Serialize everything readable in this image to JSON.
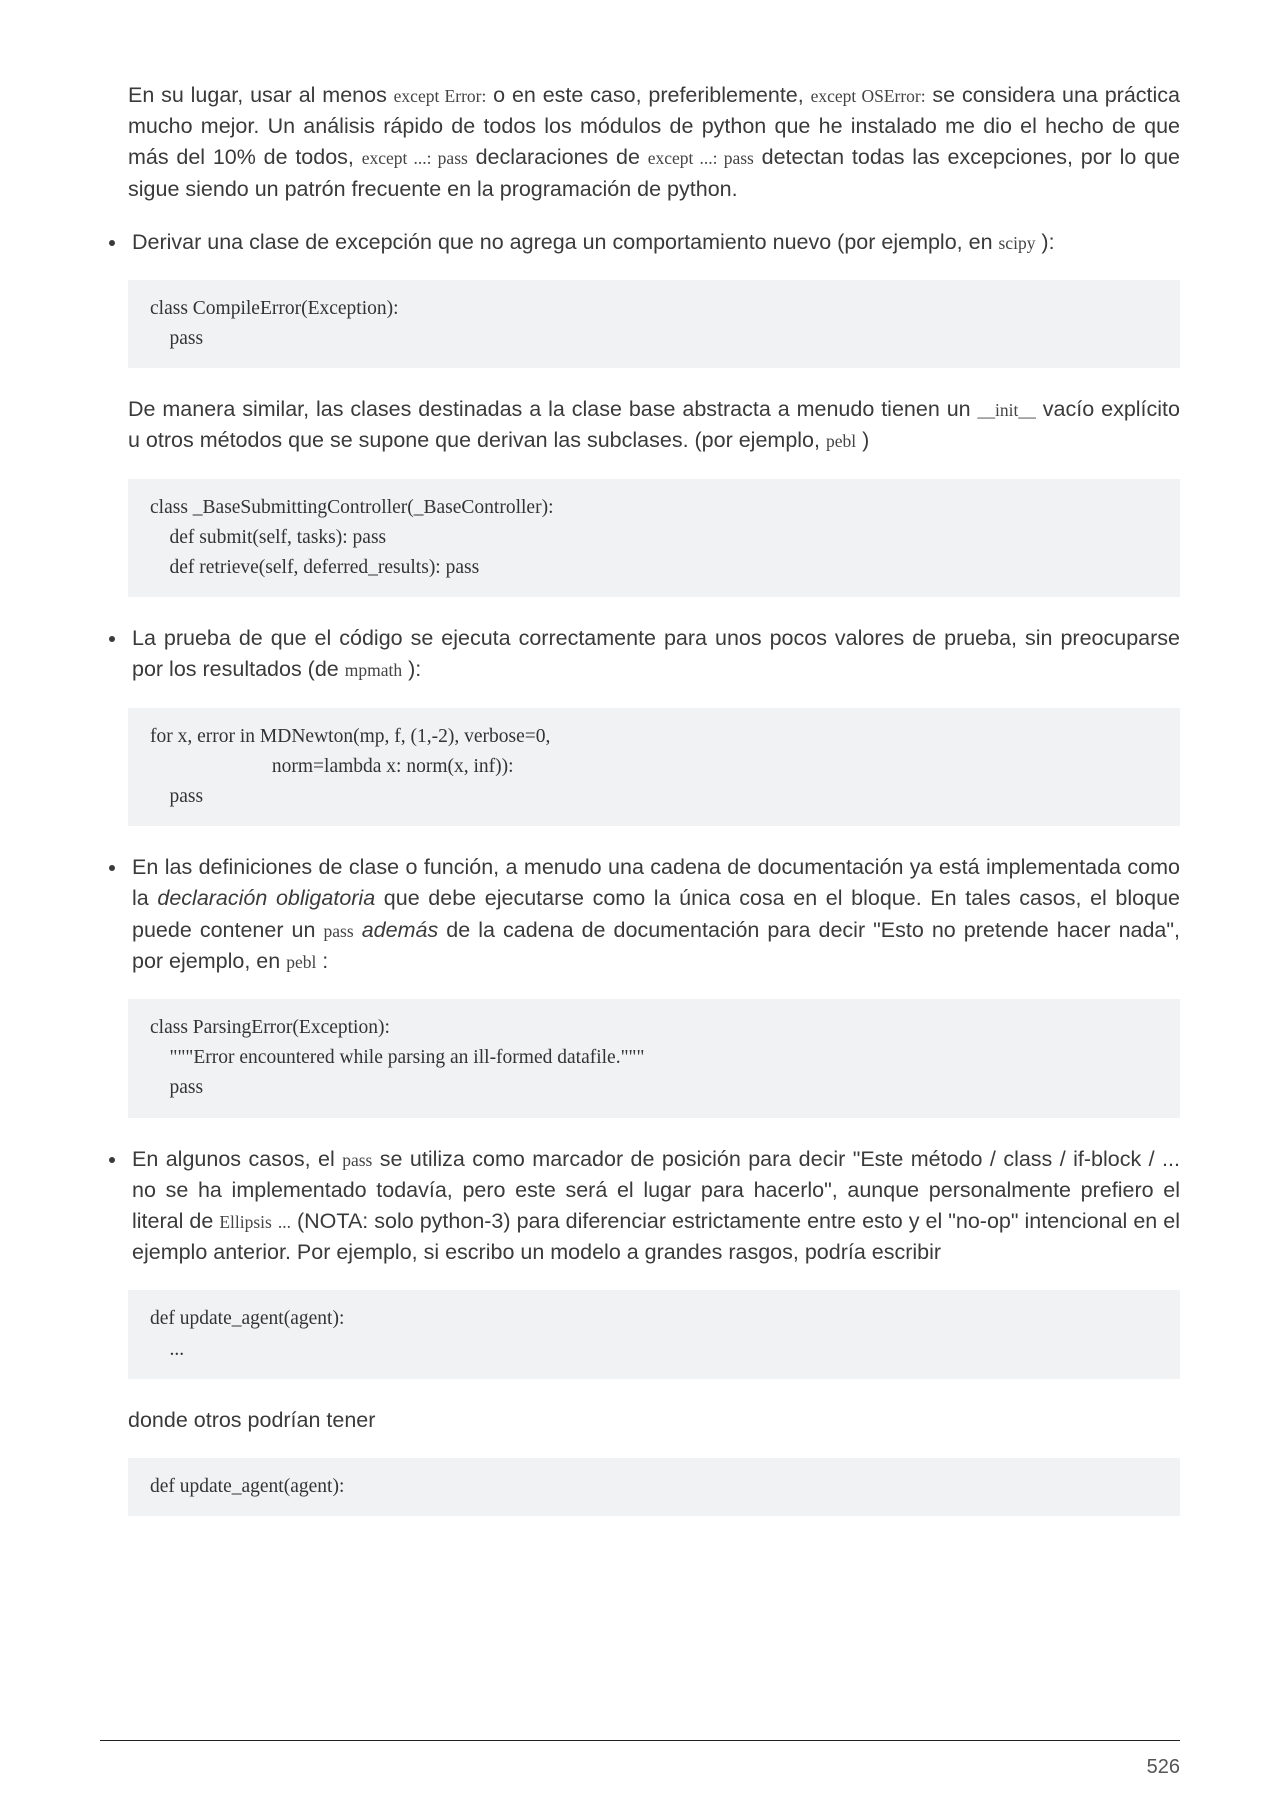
{
  "intro": {
    "t1": "En su lugar, usar al menos ",
    "c1": "except Error:",
    "t2": " o en este caso, preferiblemente, ",
    "c2": "except OSError:",
    "t3": " se considera una práctica mucho mejor. Un análisis rápido de todos los módulos de python que he instalado me dio el hecho de que más del 10% de todos, ",
    "c3": "except ...: pass",
    "t4": " declaraciones de ",
    "c4": "except ...: pass",
    "t5": " detectan todas las excepciones, por lo que sigue siendo un patrón frecuente en la programación de python."
  },
  "bullet1": {
    "t1": "Derivar una clase de excepción que no agrega un comportamiento nuevo (por ejemplo, en ",
    "c1": "scipy",
    "t2": " ):"
  },
  "code1": "class CompileError(Exception):\n    pass",
  "para2": {
    "t1": "De manera similar, las clases destinadas a la clase base abstracta a menudo tienen un ",
    "c1": "__init__",
    "t2": " vacío explícito u otros métodos que se supone que derivan las subclases. (por ejemplo, ",
    "c2": "pebl",
    "t3": " )"
  },
  "code2": "class _BaseSubmittingController(_BaseController):\n    def submit(self, tasks): pass\n    def retrieve(self, deferred_results): pass",
  "bullet2": {
    "t1": "La prueba de que el código se ejecuta correctamente para unos pocos valores de prueba, sin preocuparse por los resultados (de ",
    "c1": "mpmath",
    "t2": " ):"
  },
  "code3": "for x, error in MDNewton(mp, f, (1,-2), verbose=0,\n                         norm=lambda x: norm(x, inf)):\n    pass",
  "bullet3": {
    "t1": "En las definiciones de clase o función, a menudo una cadena de documentación ya está implementada como la ",
    "em1": "declaración obligatoria",
    "t2": " que debe ejecutarse como la única cosa en el bloque. En tales casos, el bloque puede contener un ",
    "c1": "pass",
    "t3": " ",
    "em2": "además",
    "t4": " de la cadena de documentación para decir \"Esto no pretende hacer nada\", por ejemplo, en ",
    "c2": "pebl",
    "t5": " :"
  },
  "code4": "class ParsingError(Exception):\n    \"\"\"Error encountered while parsing an ill-formed datafile.\"\"\"\n    pass",
  "bullet4": {
    "t1": "En algunos casos, el ",
    "c1": "pass",
    "t2": " se utiliza como marcador de posición para decir \"Este método / class / if-block / ... no se ha implementado todavía, pero este será el lugar para hacerlo\", aunque personalmente prefiero el literal de ",
    "c2": "Ellipsis",
    "t3": " ",
    "c3": "...",
    "t4": " (NOTA: solo python-3) para diferenciar estrictamente entre esto y el \"no-op\" intencional en el ejemplo anterior. Por ejemplo, si escribo un modelo a grandes rasgos, podría escribir"
  },
  "code5": "def update_agent(agent):\n    ...",
  "para5": "donde otros podrían tener",
  "code6": "def update_agent(agent):",
  "page_number": "526"
}
